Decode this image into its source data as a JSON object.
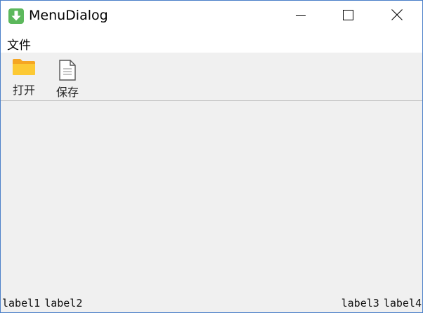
{
  "window": {
    "title": "MenuDialog",
    "app_icon": "download-arrow-icon",
    "controls": {
      "minimize_icon": "minimize-icon",
      "maximize_icon": "maximize-icon",
      "close_icon": "close-icon"
    },
    "accent_color": "#4a7fc9"
  },
  "menubar": {
    "items": [
      {
        "label": "文件"
      }
    ]
  },
  "toolbar": {
    "items": [
      {
        "label": "打开",
        "icon": "folder-icon"
      },
      {
        "label": "保存",
        "icon": "document-icon"
      }
    ]
  },
  "statusbar": {
    "left": [
      "label1",
      "label2"
    ],
    "right": [
      "label3",
      "label4"
    ]
  }
}
